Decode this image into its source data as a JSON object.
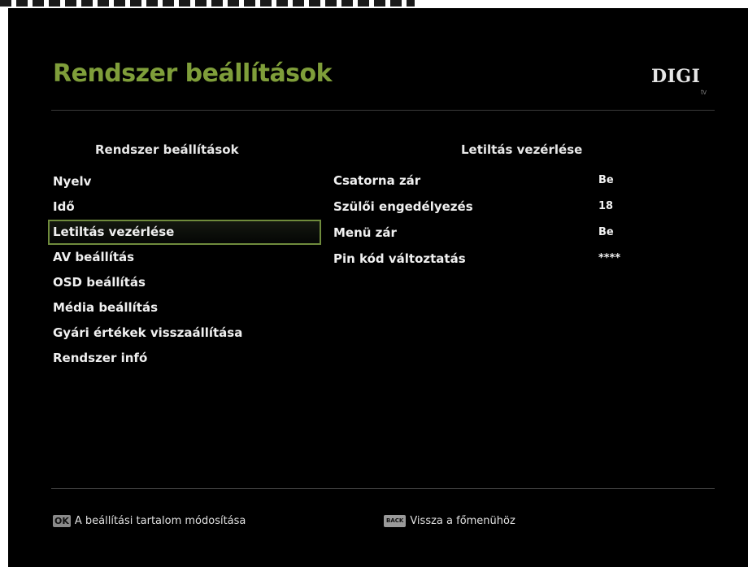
{
  "header": {
    "title": "Rendszer beállítások",
    "brand": "DIGI",
    "brand_sub": "tv"
  },
  "left_column": {
    "heading": "Rendszer beállítások",
    "items": [
      {
        "label": "Nyelv"
      },
      {
        "label": "Idő"
      },
      {
        "label": "Letiltás vezérlése",
        "selected": true
      },
      {
        "label": "AV beállítás"
      },
      {
        "label": "OSD beállítás"
      },
      {
        "label": "Média beállítás"
      },
      {
        "label": "Gyári értékek visszaállítása"
      },
      {
        "label": "Rendszer infó"
      }
    ]
  },
  "right_column": {
    "heading": "Letiltás vezérlése",
    "rows": [
      {
        "label": "Csatorna zár",
        "value": "Be"
      },
      {
        "label": "Szülői engedélyezés",
        "value": "18"
      },
      {
        "label": "Menü zár",
        "value": "Be"
      },
      {
        "label": "Pin kód változtatás",
        "value": "****"
      }
    ]
  },
  "footer": {
    "ok_key": "OK",
    "ok_hint": "A beállítási tartalom módosítása",
    "back_key": "BACK",
    "back_hint": "Vissza a főmenühöz"
  },
  "colors": {
    "accent": "#7f9e3a",
    "selection_border": "#6f8b3c",
    "background": "#000000",
    "text": "#f0f0f0"
  }
}
